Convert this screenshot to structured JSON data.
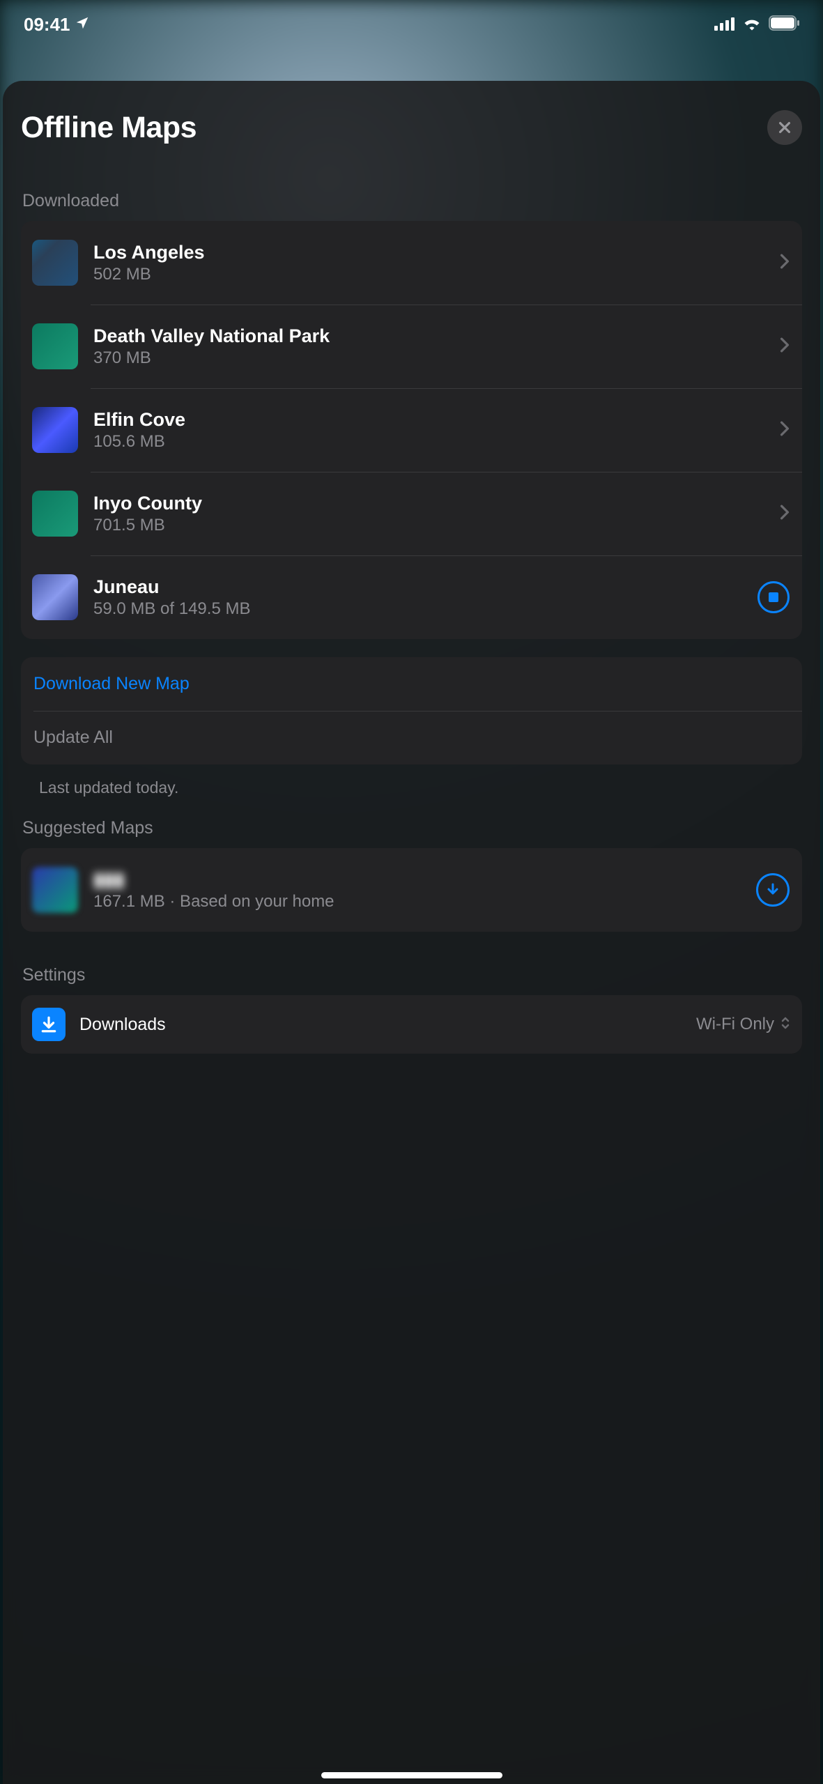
{
  "status": {
    "time": "09:41"
  },
  "sheet": {
    "title": "Offline Maps"
  },
  "sections": {
    "downloaded_label": "Downloaded",
    "suggested_label": "Suggested Maps",
    "settings_label": "Settings"
  },
  "downloaded": [
    {
      "name": "Los Angeles",
      "size": "502 MB"
    },
    {
      "name": "Death Valley National Park",
      "size": "370 MB"
    },
    {
      "name": "Elfin Cove",
      "size": "105.6 MB"
    },
    {
      "name": "Inyo County",
      "size": "701.5 MB"
    },
    {
      "name": "Juneau",
      "size": "59.0 MB of 149.5 MB"
    }
  ],
  "actions": {
    "download_new": "Download New Map",
    "update_all": "Update All",
    "last_updated": "Last updated today."
  },
  "suggested": [
    {
      "name": "▮▮▮",
      "sub": "167.1 MB · Based on your home"
    }
  ],
  "settings": {
    "downloads_label": "Downloads",
    "downloads_value": "Wi-Fi Only"
  }
}
